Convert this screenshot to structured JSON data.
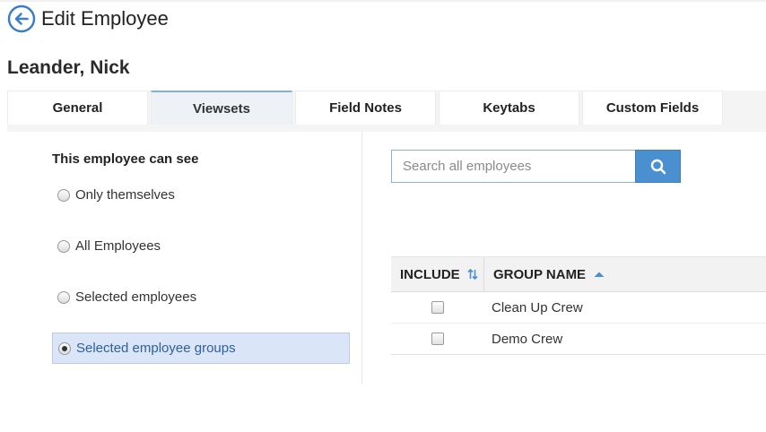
{
  "header": {
    "title_prefix": "Edit",
    "title_main": "Employee",
    "back_icon": "arrow-left-circle-icon"
  },
  "employee": {
    "name": "Leander, Nick"
  },
  "tabs": [
    {
      "label": "General",
      "active": false
    },
    {
      "label": "Viewsets",
      "active": true
    },
    {
      "label": "Field Notes",
      "active": false
    },
    {
      "label": "Keytabs",
      "active": false
    },
    {
      "label": "Custom Fields",
      "active": false
    }
  ],
  "visibility": {
    "title": "This employee can see",
    "options": [
      {
        "label": "Only themselves",
        "checked": false
      },
      {
        "label": "All Employees",
        "checked": false
      },
      {
        "label": "Selected employees",
        "checked": false
      },
      {
        "label": "Selected employee groups",
        "checked": true
      }
    ]
  },
  "search": {
    "placeholder": "Search all employees",
    "value": "",
    "icon": "search-icon"
  },
  "groups_table": {
    "columns": {
      "include": "INCLUDE",
      "group_name": "GROUP NAME"
    },
    "rows": [
      {
        "name": "Clean Up Crew",
        "included": false
      },
      {
        "name": "Demo Crew",
        "included": false
      }
    ]
  },
  "colors": {
    "accent": "#4a8fd0",
    "selected_bg": "#dae6f7",
    "back_icon": "#3d7fc4"
  }
}
